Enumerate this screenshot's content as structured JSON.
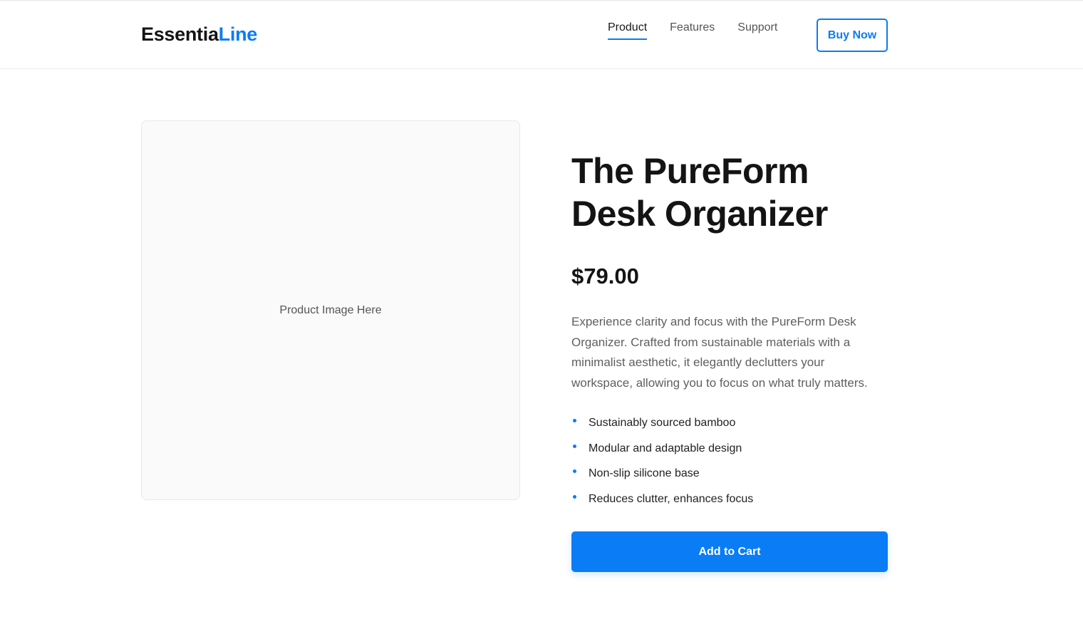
{
  "header": {
    "logo_main": "Essentia",
    "logo_accent": "Line",
    "nav": [
      {
        "label": "Product",
        "active": true
      },
      {
        "label": "Features",
        "active": false
      },
      {
        "label": "Support",
        "active": false
      }
    ],
    "buy_now_label": "Buy Now"
  },
  "product": {
    "image_placeholder": "Product Image Here",
    "title_line1": "The PureForm",
    "title_line2": "Desk Organizer",
    "price": "$79.00",
    "description": "Experience clarity and focus with the PureForm Desk Organizer. Crafted from sustainable materials with a minimalist aesthetic, it elegantly declutters your workspace, allowing you to focus on what truly matters.",
    "features": [
      "Sustainably sourced bamboo",
      "Modular and adaptable design",
      "Non-slip silicone base",
      "Reduces clutter, enhances focus"
    ],
    "add_to_cart_label": "Add to Cart"
  },
  "colors": {
    "accent": "#0a7cf6",
    "text_dark": "#141414",
    "text_muted": "#5f5f5f"
  },
  "icons": {
    "feature_bullet": "dot-bullet-icon"
  }
}
